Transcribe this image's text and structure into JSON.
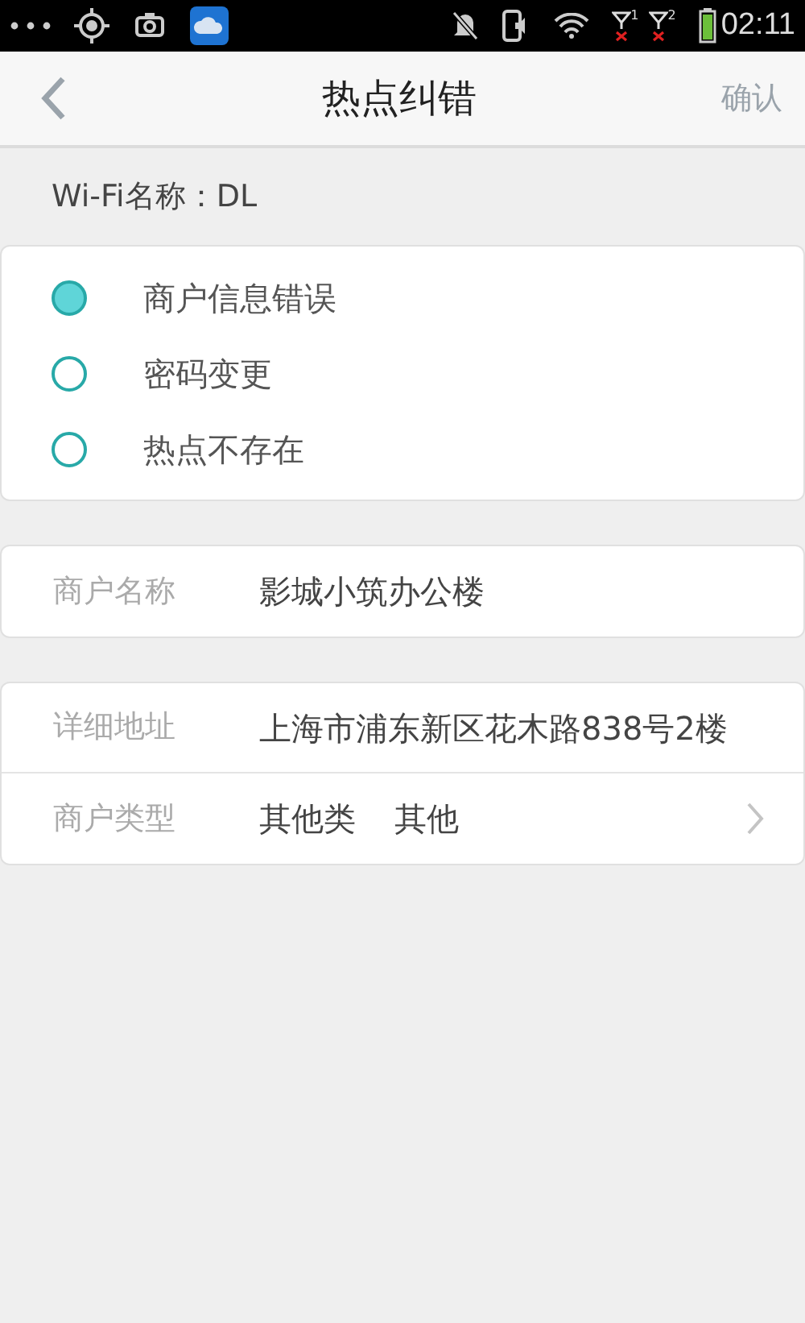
{
  "status_bar": {
    "time": "02:11",
    "sim_labels": [
      "1",
      "2"
    ]
  },
  "header": {
    "title": "热点纠错",
    "confirm": "确认"
  },
  "wifi_name": {
    "label": "Wi-Fi名称：",
    "value": "DL"
  },
  "reasons": [
    {
      "label": "商户信息错误",
      "selected": true
    },
    {
      "label": "密码变更",
      "selected": false
    },
    {
      "label": "热点不存在",
      "selected": false
    }
  ],
  "merchant_name": {
    "label": "商户名称",
    "value": "影城小筑办公楼"
  },
  "details": [
    {
      "kind": "text",
      "label": "详细地址",
      "value": "上海市浦东新区花木路838号2楼"
    },
    {
      "kind": "link",
      "label": "商户类型",
      "value": "其他类",
      "extra": "其他"
    }
  ]
}
